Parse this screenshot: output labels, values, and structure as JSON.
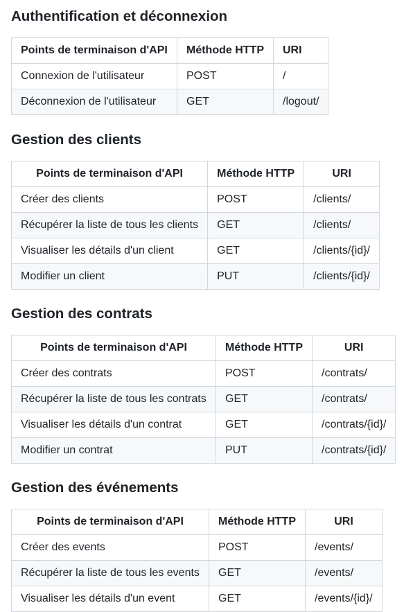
{
  "sections": [
    {
      "title": "Authentification et déconnexion",
      "headers": [
        "Points de terminaison d'API",
        "Méthode HTTP",
        "URI"
      ],
      "rows": [
        [
          "Connexion de l'utilisateur",
          "POST",
          "/"
        ],
        [
          "Déconnexion de l'utilisateur",
          "GET",
          "/logout/"
        ]
      ]
    },
    {
      "title": "Gestion des clients",
      "headers": [
        "Points de terminaison d'API",
        "Méthode HTTP",
        "URI"
      ],
      "rows": [
        [
          "Créer des clients",
          "POST",
          "/clients/"
        ],
        [
          "Récupérer la liste de tous les clients",
          "GET",
          "/clients/"
        ],
        [
          "Visualiser les détails d'un client",
          "GET",
          "/clients/{id}/"
        ],
        [
          "Modifier un client",
          "PUT",
          "/clients/{id}/"
        ]
      ]
    },
    {
      "title": "Gestion des contrats",
      "headers": [
        "Points de terminaison d'API",
        "Méthode HTTP",
        "URI"
      ],
      "rows": [
        [
          "Créer des contrats",
          "POST",
          "/contrats/"
        ],
        [
          "Récupérer la liste de tous les contrats",
          "GET",
          "/contrats/"
        ],
        [
          "Visualiser les détails d'un contrat",
          "GET",
          "/contrats/{id}/"
        ],
        [
          "Modifier un contrat",
          "PUT",
          "/contrats/{id}/"
        ]
      ]
    },
    {
      "title": "Gestion des événements",
      "headers": [
        "Points de terminaison d'API",
        "Méthode HTTP",
        "URI"
      ],
      "rows": [
        [
          "Créer des events",
          "POST",
          "/events/"
        ],
        [
          "Récupérer la liste de tous les events",
          "GET",
          "/events/"
        ],
        [
          "Visualiser les détails d'un event",
          "GET",
          "/events/{id}/"
        ]
      ]
    }
  ]
}
